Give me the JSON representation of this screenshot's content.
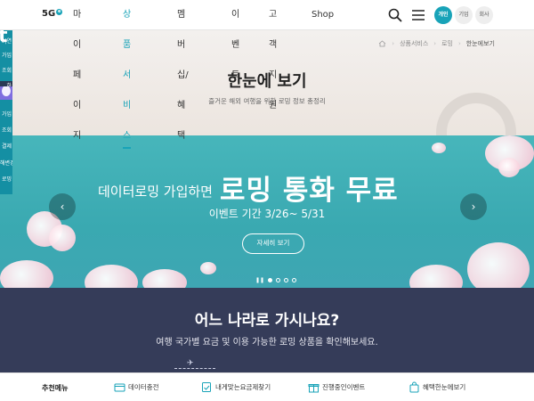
{
  "header": {
    "logo": "5G",
    "logo_badge": "e",
    "nav": [
      "마이페이지",
      "상품서비스",
      "멤버십/혜택",
      "이벤트",
      "고객지원",
      "Shop"
    ],
    "segments": [
      "개인",
      "기업",
      "회사"
    ]
  },
  "sidebar": {
    "letter": "t",
    "rows": [
      "0|연",
      "가입",
      "조회",
      "하",
      "가입",
      "조회",
      "결제",
      "해변경",
      "로밍"
    ]
  },
  "hero": {
    "breadcrumb": [
      "상품서비스",
      "로밍",
      "한눈에보기"
    ],
    "title": "한눈에 보기",
    "subtitle": "즐거운 해외 여행을 위한 로밍 정보 총정리"
  },
  "banner": {
    "line1": "데이터로밍 가입하면",
    "line1_big": "로밍 통화 무료",
    "date": "이벤트 기간 3/26~ 5/31",
    "button": "자세히 보기",
    "pause": "❚❚",
    "slides_total": 4,
    "slide_active": 1
  },
  "destination": {
    "title": "어느 나라로 가시나요?",
    "subtitle": "여행 국가별 요금 및 이용 가능한 로밍 상품을 확인해보세요."
  },
  "recommend": {
    "label": "추천메뉴",
    "items": [
      "데이터충전",
      "내게맞는요금제찾기",
      "진행중인이벤트",
      "혜택한눈에보기"
    ]
  },
  "colors": {
    "accent": "#18a3b8",
    "banner": "#3ea6b3",
    "dest_bg": "#353c59"
  }
}
